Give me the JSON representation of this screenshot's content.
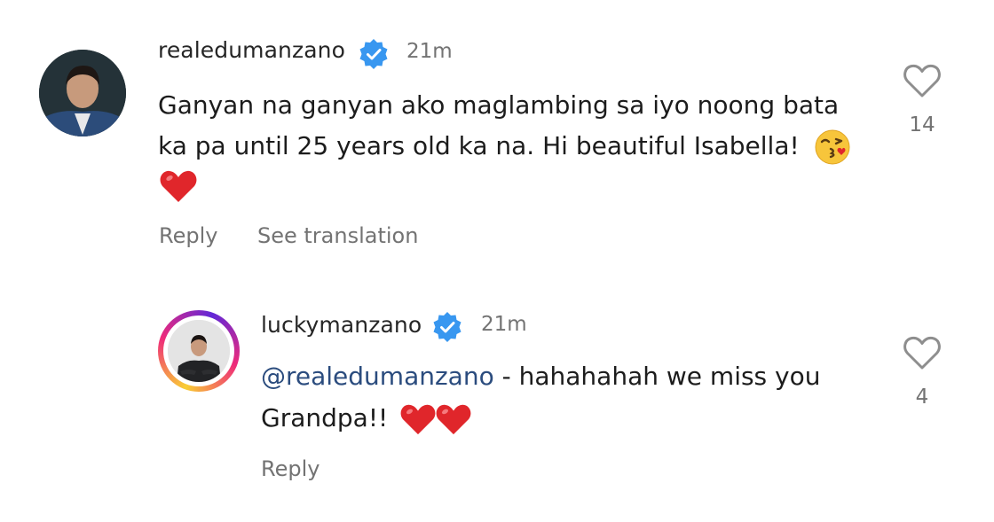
{
  "comments": [
    {
      "username": "realedumanzano",
      "time": "21m",
      "text_line1": "Ganyan na ganyan ako maglambing sa iyo noong bata",
      "text_line2": "ka pa until 25 years old ka na. Hi beautiful Isabella!",
      "likes": "14",
      "reply_label": "Reply",
      "translation_label": "See translation",
      "icons": [
        "verified-badge-icon",
        "kissing-face-emoji",
        "red-heart-emoji",
        "heart-outline-icon"
      ]
    },
    {
      "username": "luckymanzano",
      "time": "21m",
      "mention": "@realedumanzano",
      "text_rest": " - hahahahah we miss you",
      "text_line2": "Grandpa!!",
      "likes": "4",
      "reply_label": "Reply",
      "icons": [
        "verified-badge-icon",
        "red-heart-emoji",
        "red-heart-emoji",
        "heart-outline-icon"
      ]
    }
  ],
  "colors": {
    "verified_blue": "#3897f0",
    "heart_red": "#e0262b",
    "secondary_text": "#737373",
    "mention_blue": "#2b4c7e",
    "story_ring": [
      "#f9ce34",
      "#ee2a7b",
      "#6228d7"
    ]
  }
}
